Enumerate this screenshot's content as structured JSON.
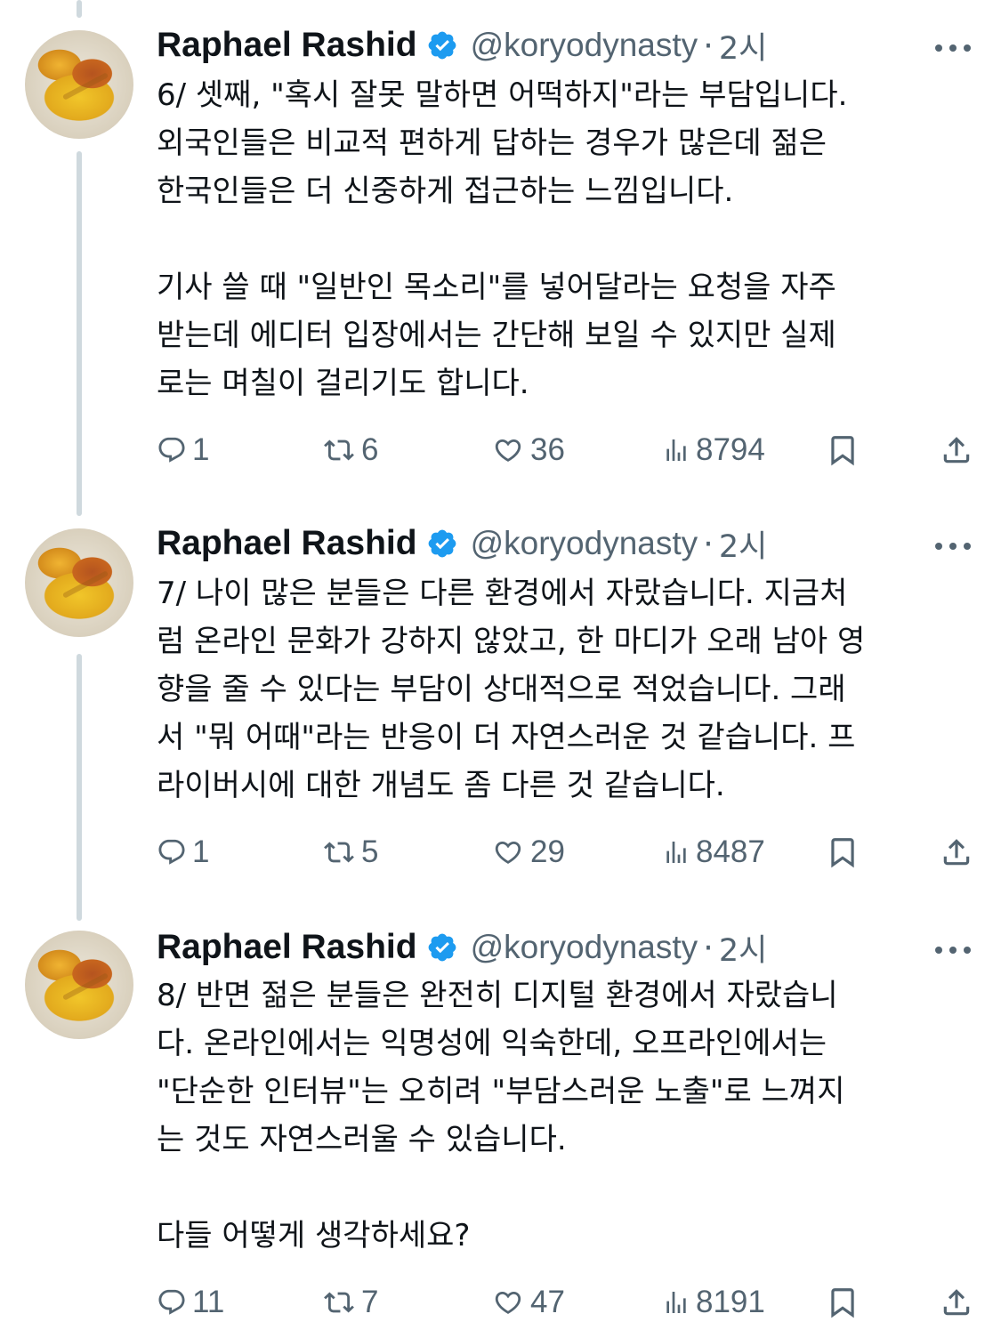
{
  "tweets": [
    {
      "author": {
        "name": "Raphael Rashid",
        "handle": "@koryodynasty",
        "time": "2시"
      },
      "lines": [
        "6/ 셋째, \"혹시 잘못 말하면 어떡하지\"라는 부담입니다.",
        "외국인들은 비교적 편하게 답하는 경우가 많은데 젊은",
        "한국인들은 더 신중하게 접근하는 느낌입니다.",
        "",
        "기사 쓸 때 \"일반인 목소리\"를 넣어달라는 요청을 자주",
        "받는데 에디터 입장에서는 간단해 보일 수 있지만 실제",
        "로는 며칠이 걸리기도 합니다."
      ],
      "stats": {
        "replies": "1",
        "reposts": "6",
        "likes": "36",
        "views": "8794"
      }
    },
    {
      "author": {
        "name": "Raphael Rashid",
        "handle": "@koryodynasty",
        "time": "2시"
      },
      "lines": [
        "7/ 나이 많은 분들은 다른 환경에서 자랐습니다. 지금처",
        "럼 온라인 문화가 강하지 않았고, 한 마디가 오래 남아 영",
        "향을 줄 수 있다는 부담이 상대적으로 적었습니다. 그래",
        "서 \"뭐 어때\"라는 반응이 더 자연스러운 것 같습니다. 프",
        "라이버시에 대한 개념도 좀 다른 것 같습니다."
      ],
      "stats": {
        "replies": "1",
        "reposts": "5",
        "likes": "29",
        "views": "8487"
      }
    },
    {
      "author": {
        "name": "Raphael Rashid",
        "handle": "@koryodynasty",
        "time": "2시"
      },
      "lines": [
        "8/ 반면 젊은 분들은 완전히 디지털 환경에서 자랐습니",
        "다. 온라인에서는 익명성에 익숙한데, 오프라인에서는",
        "\"단순한 인터뷰\"는 오히려 \"부담스러운 노출\"로 느껴지",
        "는 것도 자연스러울 수 있습니다.",
        "",
        "다들 어떻게 생각하세요?"
      ],
      "stats": {
        "replies": "11",
        "reposts": "7",
        "likes": "47",
        "views": "8191"
      }
    }
  ],
  "colors": {
    "text": "#0f1419",
    "secondary": "#536471",
    "verified": "#1d9bf0",
    "thread": "#cfd9de"
  },
  "icons": [
    "verified-badge-icon",
    "more-icon",
    "reply-icon",
    "repost-icon",
    "like-icon",
    "views-icon",
    "bookmark-icon",
    "share-icon"
  ]
}
